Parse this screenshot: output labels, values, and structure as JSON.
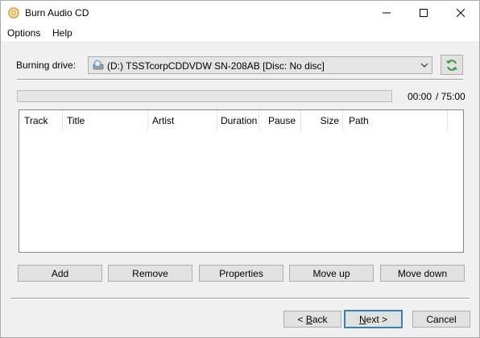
{
  "window": {
    "title": "Burn Audio CD"
  },
  "menu": {
    "items": [
      "Options",
      "Help"
    ]
  },
  "drive": {
    "label": "Burning drive:",
    "selected": "(D:) TSSTcorpCDDVDW SN-208AB [Disc: No disc]"
  },
  "progress": {
    "current": "00:00",
    "total": "/ 75:00",
    "fraction": 0
  },
  "tracklist": {
    "columns": [
      "Track",
      "Title",
      "Artist",
      "Duration",
      "Pause",
      "Size",
      "Path"
    ],
    "rows": []
  },
  "actions": {
    "add": "Add",
    "remove": "Remove",
    "properties": "Properties",
    "move_up": "Move up",
    "move_down": "Move down"
  },
  "footer": {
    "back_prefix": "< ",
    "back_key": "B",
    "back_rest": "ack",
    "next_key": "N",
    "next_rest": "ext >",
    "cancel": "Cancel"
  },
  "colors": {
    "default_button_border": "#3c7fb1",
    "refresh_icon": "#3a9a3a"
  }
}
